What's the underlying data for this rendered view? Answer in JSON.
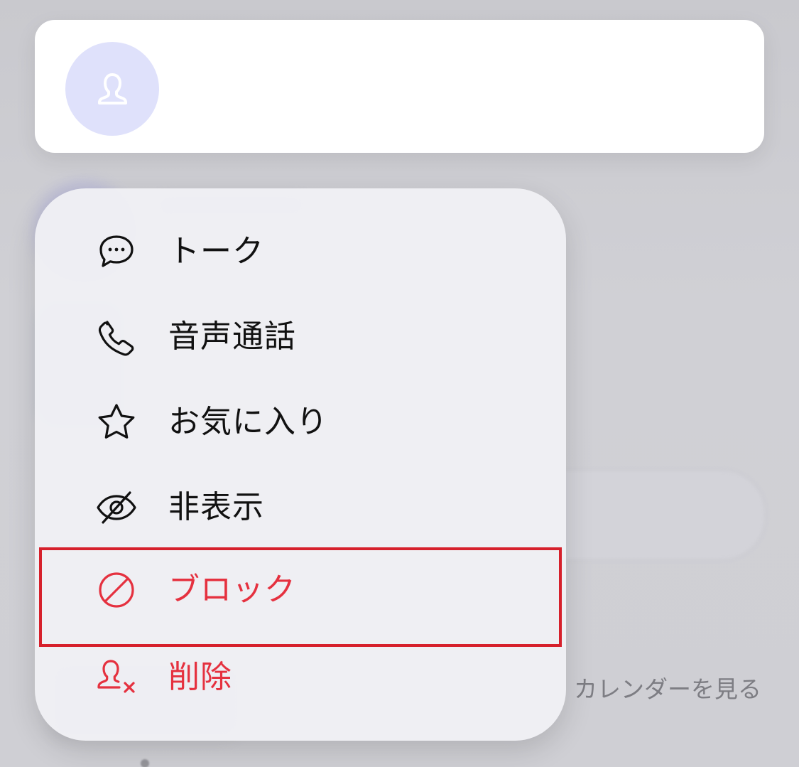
{
  "contact_card": {
    "avatar_icon": "person-icon"
  },
  "menu": {
    "items": [
      {
        "key": "talk",
        "label": "トーク",
        "icon": "chat-bubble-icon"
      },
      {
        "key": "voice_call",
        "label": "音声通話",
        "icon": "phone-icon"
      },
      {
        "key": "favorite",
        "label": "お気に入り",
        "icon": "star-icon"
      },
      {
        "key": "hide",
        "label": "非表示",
        "icon": "eye-off-icon"
      },
      {
        "key": "block",
        "label": "ブロック",
        "icon": "block-icon",
        "highlighted": true
      },
      {
        "key": "delete",
        "label": "削除",
        "icon": "remove-user-icon"
      }
    ]
  },
  "footer": {
    "calendar_link": "カレンダーを見る"
  },
  "colors": {
    "background": "#cfcfd4",
    "menu_background": "#efeff4",
    "danger": "#e5313f",
    "highlight_border": "#d6202b",
    "avatar_background": "#dfe1fb"
  }
}
